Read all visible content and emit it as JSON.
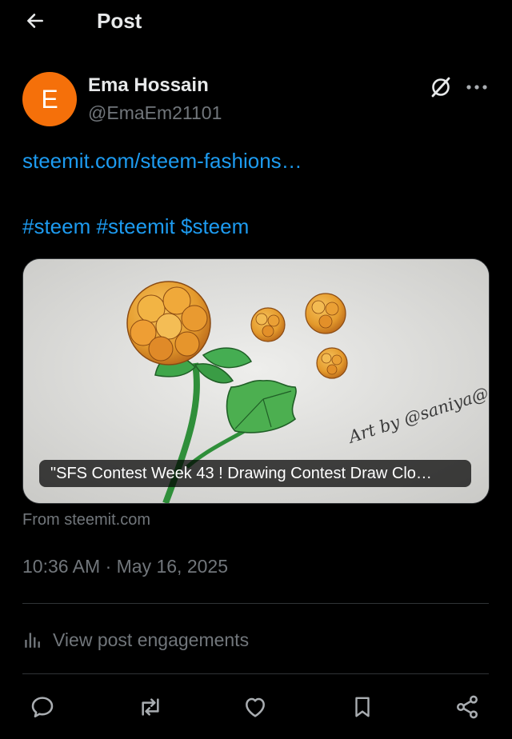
{
  "header": {
    "title": "Post"
  },
  "author": {
    "avatar_letter": "E",
    "avatar_color": "#f5700a",
    "name": "Ema Hossain",
    "handle": "@EmaEm21101"
  },
  "post": {
    "link_text": "steemit.com/steem-fashions…",
    "hashtags": [
      "#steem",
      "#steemit",
      "$steem"
    ]
  },
  "card": {
    "caption": "\"SFS Contest Week 43 ! Drawing Contest Draw Clo…",
    "image_signature": "Art by @saniya@",
    "from_label": "From steemit.com"
  },
  "timestamp": "10:36 AM · May 16, 2025",
  "engagements_label": "View post engagements",
  "icons": {
    "back": "arrow-left-icon",
    "grok": "grok-icon",
    "more": "more-horizontal-icon",
    "analytics": "bar-chart-icon",
    "reply": "reply-icon",
    "repost": "repost-icon",
    "like": "heart-icon",
    "bookmark": "bookmark-icon",
    "share": "share-icon"
  },
  "colors": {
    "background": "#000000",
    "link": "#1d9bf0",
    "secondary_text": "#71767b",
    "primary_text": "#e7e9ea",
    "divider": "#2f3336"
  }
}
